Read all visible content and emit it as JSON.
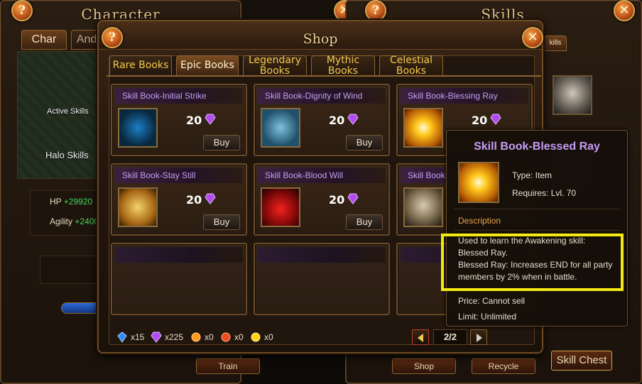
{
  "character_window": {
    "title": "Character",
    "tabs": [
      "Char",
      "And"
    ],
    "active_skills_label": "Active Skills",
    "halo_skills_label": "Halo Skills",
    "stats": [
      {
        "label": "HP",
        "value": "+29920"
      },
      {
        "label": "Agility",
        "value": "+2400"
      }
    ],
    "bottom_buttons": [
      "Train"
    ]
  },
  "skills_window": {
    "title": "Skills",
    "tab_label": "kills",
    "buttons": {
      "shop": "Shop",
      "recycle": "Recycle",
      "skill_chest": "Skill Chest"
    }
  },
  "shop": {
    "title": "Shop",
    "tabs": [
      {
        "label": "Rare Books",
        "active": false
      },
      {
        "label": "Epic Books",
        "active": true
      },
      {
        "label": "Legendary Books",
        "active": false
      },
      {
        "label": "Mythic Books",
        "active": false
      },
      {
        "label": "Celestial Books",
        "active": false
      }
    ],
    "items": [
      {
        "name": "Skill Book-Initial Strike",
        "price": "20",
        "buy": "Buy",
        "icon": "initial-strike-icon"
      },
      {
        "name": "Skill Book-Dignity of Wind",
        "price": "20",
        "buy": "Buy",
        "icon": "dignity-of-wind-icon"
      },
      {
        "name": "Skill Book-Blessing Ray",
        "price": "20",
        "buy": "Buy",
        "icon": "blessing-ray-icon"
      },
      {
        "name": "Skill Book-Stay Still",
        "price": "20",
        "buy": "Buy",
        "icon": "stay-still-icon"
      },
      {
        "name": "Skill Book-Blood Will",
        "price": "20",
        "buy": "Buy",
        "icon": "blood-will-icon"
      },
      {
        "name": "Skill Book",
        "price": "",
        "buy": "",
        "icon": "awakening-icon"
      }
    ],
    "currencies": [
      {
        "icon": "blue-gem-icon",
        "amount": "x15",
        "color": "#2f8bff"
      },
      {
        "icon": "purple-gem-icon",
        "amount": "x225",
        "color": "#b24cf0"
      },
      {
        "icon": "orange-gem-icon",
        "amount": "x0",
        "color": "#ff9a1a"
      },
      {
        "icon": "red-gem-icon",
        "amount": "x0",
        "color": "#f04a1a"
      },
      {
        "icon": "yellow-gem-icon",
        "amount": "x0",
        "color": "#ffd21a"
      }
    ],
    "pager": {
      "value": "2/2"
    }
  },
  "tooltip": {
    "title": "Skill Book-Blessed Ray",
    "type": "Type: Item",
    "requires": "Requires: Lvl. 70",
    "description_heading": "Description",
    "description_lines": [
      "Used to learn the Awakening skill:",
      "Blessed Ray.",
      "Blessed Ray: Increases END for all party",
      "members by 2% when in battle."
    ],
    "price": "Price: Cannot sell",
    "limit": "Limit: Unlimited"
  },
  "colors": {
    "accent_gold": "#e8cf94",
    "item_name_purple": "#c69ef2",
    "tab_text": "#f2c84b",
    "highlight": "#f2ea12",
    "stat_green": "#49d75a"
  }
}
